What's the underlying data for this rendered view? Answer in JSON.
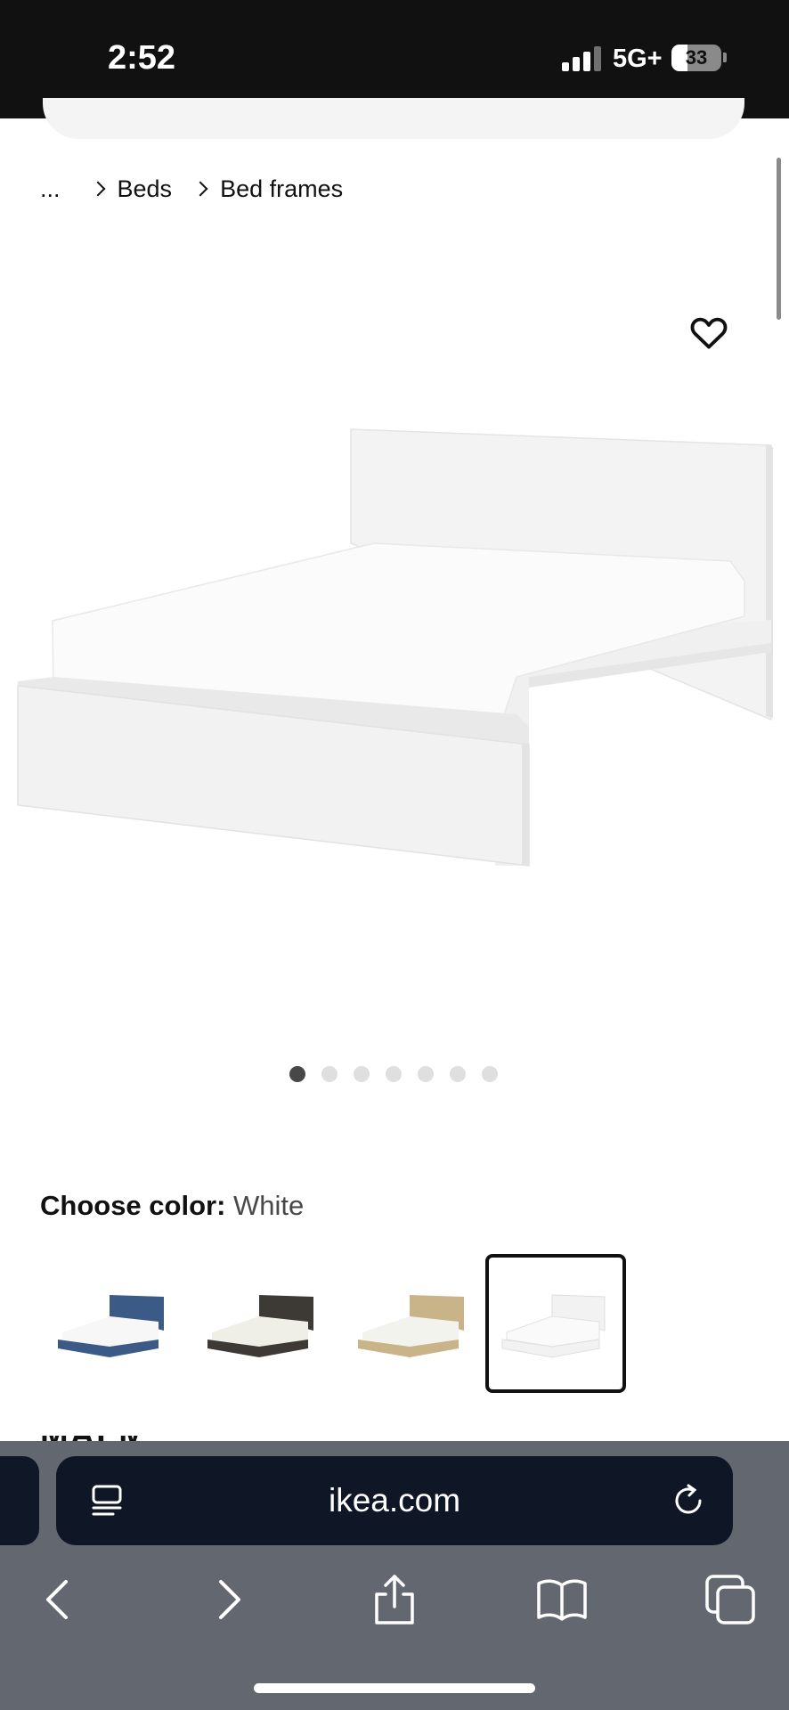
{
  "status_bar": {
    "time": "2:52",
    "network": "5G+",
    "battery_level": "33",
    "battery_fraction": 0.33
  },
  "breadcrumb": {
    "ellipsis": "...",
    "items": [
      "Beds",
      "Bed frames"
    ]
  },
  "product": {
    "image_icon": "bed-frame-image",
    "favorite_icon": "heart-icon",
    "gallery": {
      "total": 7,
      "active_index": 0
    }
  },
  "color_picker": {
    "label": "Choose color:",
    "selected_value": "White",
    "options": [
      {
        "name": "dark-blue",
        "color": "#3b5a86"
      },
      {
        "name": "black-brown",
        "color": "#3d3935"
      },
      {
        "name": "oak-veneer",
        "color": "#c9b389"
      },
      {
        "name": "white",
        "color": "#f2f2f2",
        "selected": true
      }
    ]
  },
  "browser": {
    "url": "ikea.com",
    "colors": {
      "chrome": "#636770",
      "address_bar": "#0f1626"
    },
    "toolbar": [
      "back",
      "forward",
      "share",
      "bookmarks",
      "tabs"
    ]
  }
}
